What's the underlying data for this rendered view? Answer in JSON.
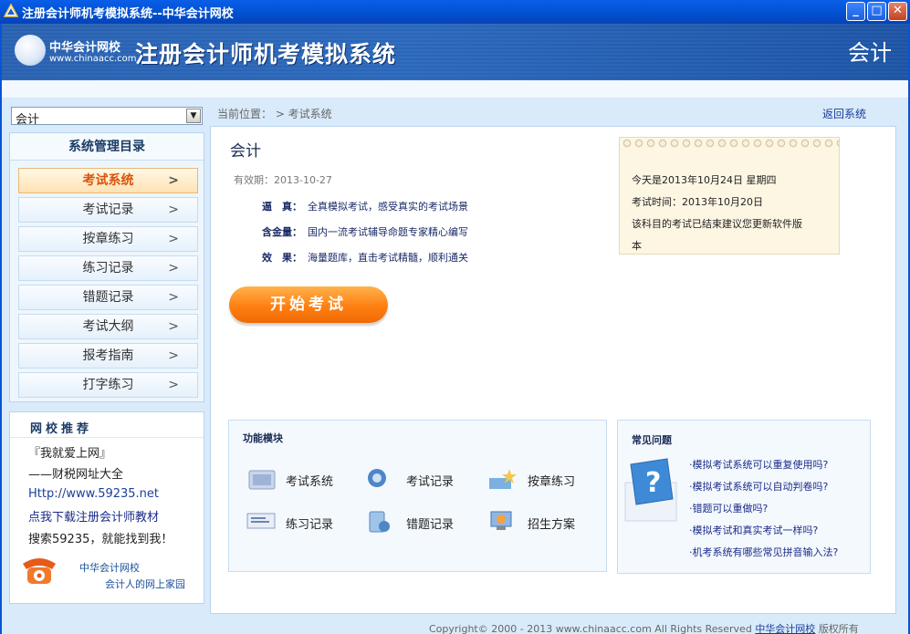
{
  "window": {
    "title": "注册会计师机考模拟系统--中华会计网校"
  },
  "banner": {
    "logo_name": "中华会计网校",
    "logo_url": "www.chinaacc.com",
    "title": "注册会计师机考模拟系统",
    "subject": "会计"
  },
  "sidebar": {
    "subject_value": "会计",
    "menu_title": "系统管理目录",
    "items": [
      {
        "label": "考试系统",
        "active": true
      },
      {
        "label": "考试记录"
      },
      {
        "label": "按章练习"
      },
      {
        "label": "练习记录"
      },
      {
        "label": "错题记录"
      },
      {
        "label": "考试大纲"
      },
      {
        "label": "报考指南"
      },
      {
        "label": "打字练习"
      }
    ],
    "chevron": ">",
    "recommend": {
      "title": "网校推荐",
      "line1": "『我就爱上网』",
      "line2": "——财税网址大全",
      "line3": "Http://www.59235.net",
      "line4": "点我下载注册会计师教材",
      "line5": "搜索59235，就能找到我！",
      "footer1": "中华会计网校",
      "footer2": "会计人的网上家园"
    }
  },
  "breadcrumb": "当前位置： > 考试系统",
  "back_link": "返回系统",
  "content": {
    "title": "会计",
    "valid": "有效期：2013-10-27",
    "features": [
      {
        "label": "逼　真：",
        "text": "全真模拟考试，感受真实的考试场景"
      },
      {
        "label": "含金量：",
        "text": "国内一流考试辅导命题专家精心编写"
      },
      {
        "label": "效　果：",
        "text": "海量题库，直击考试精髓，顺利通关"
      }
    ],
    "start_button": "开始考试",
    "notice": {
      "line1": "今天是2013年10月24日  星期四",
      "line2": "考试时间：2013年10月20日",
      "line3": "该科目的考试已结束建议您更新软件版",
      "line4": "本"
    },
    "modules": {
      "title": "功能模块",
      "items": [
        {
          "label": "考试系统",
          "icon": "exam-system-icon"
        },
        {
          "label": "考试记录",
          "icon": "exam-record-icon"
        },
        {
          "label": "按章练习",
          "icon": "chapter-practice-icon"
        },
        {
          "label": "练习记录",
          "icon": "practice-record-icon"
        },
        {
          "label": "错题记录",
          "icon": "wrong-question-icon"
        },
        {
          "label": "招生方案",
          "icon": "enrollment-plan-icon"
        }
      ]
    },
    "faq": {
      "title": "常见问题",
      "questions": [
        "·模拟考试系统可以重复使用吗?",
        "·模拟考试系统可以自动判卷吗?",
        "·错题可以重做吗?",
        "·模拟考试和真实考试一样吗?",
        "·机考系统有哪些常见拼音输入法?"
      ]
    }
  },
  "footer": {
    "copyright": "Copyright© 2000 - 2013 www.chinaacc.com All Rights Reserved",
    "link": "中华会计网校",
    "rights": "版权所有"
  },
  "colors": {
    "accent": "#ff7f12",
    "brand": "#2a63b3",
    "link": "#1b3b9a"
  }
}
